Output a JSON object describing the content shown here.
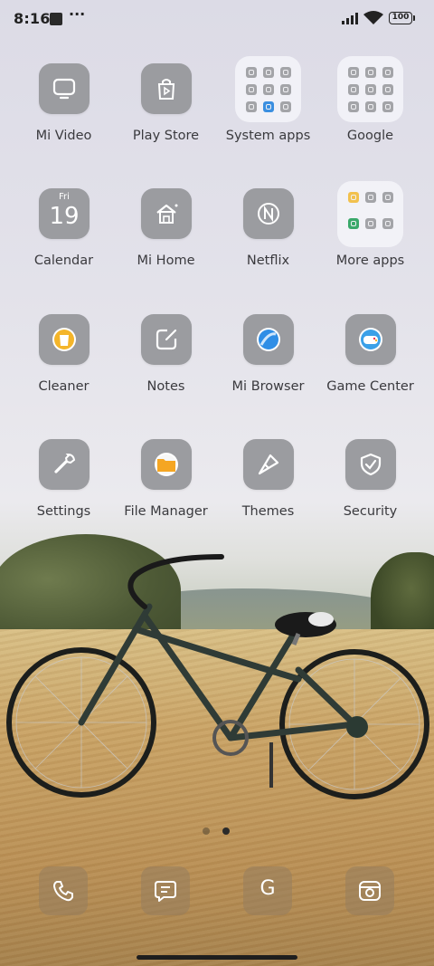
{
  "status_bar": {
    "time": "8:16",
    "more": "···",
    "battery": "100"
  },
  "apps": [
    {
      "label": "Mi Video",
      "icon": "tv-icon"
    },
    {
      "label": "Play Store",
      "icon": "shopping-bag-play-icon"
    },
    {
      "label": "System apps",
      "icon": "folder-icon"
    },
    {
      "label": "Google",
      "icon": "folder-icon"
    },
    {
      "label": "Calendar",
      "icon": "calendar-icon",
      "day": "Fri",
      "date": "19"
    },
    {
      "label": "Mi Home",
      "icon": "home-icon"
    },
    {
      "label": "Netflix",
      "icon": "netflix-icon"
    },
    {
      "label": "More apps",
      "icon": "folder-icon"
    },
    {
      "label": "Cleaner",
      "icon": "trash-bin-icon"
    },
    {
      "label": "Notes",
      "icon": "edit-note-icon"
    },
    {
      "label": "Mi Browser",
      "icon": "globe-icon"
    },
    {
      "label": "Game Center",
      "icon": "gamepad-icon"
    },
    {
      "label": "Settings",
      "icon": "wrench-icon"
    },
    {
      "label": "File Manager",
      "icon": "folder-file-icon"
    },
    {
      "label": "Themes",
      "icon": "paintbrush-icon"
    },
    {
      "label": "Security",
      "icon": "shield-check-icon"
    }
  ],
  "dock": [
    {
      "name": "Phone",
      "icon": "phone-icon"
    },
    {
      "name": "Messages",
      "icon": "message-icon"
    },
    {
      "name": "Google Search",
      "icon": "g-icon",
      "glyph": "G"
    },
    {
      "name": "Camera",
      "icon": "camera-icon"
    }
  ],
  "page_indicator": {
    "pages": 2,
    "current": 2
  },
  "colors": {
    "icon_bg": "#9b9ca0",
    "label": "#3a3a3e",
    "cleaner_accent": "#f4b52a",
    "browser_accent": "#2f8ee6",
    "game_accent": "#3aa0e8",
    "filemanager_accent": "#f5a623"
  }
}
